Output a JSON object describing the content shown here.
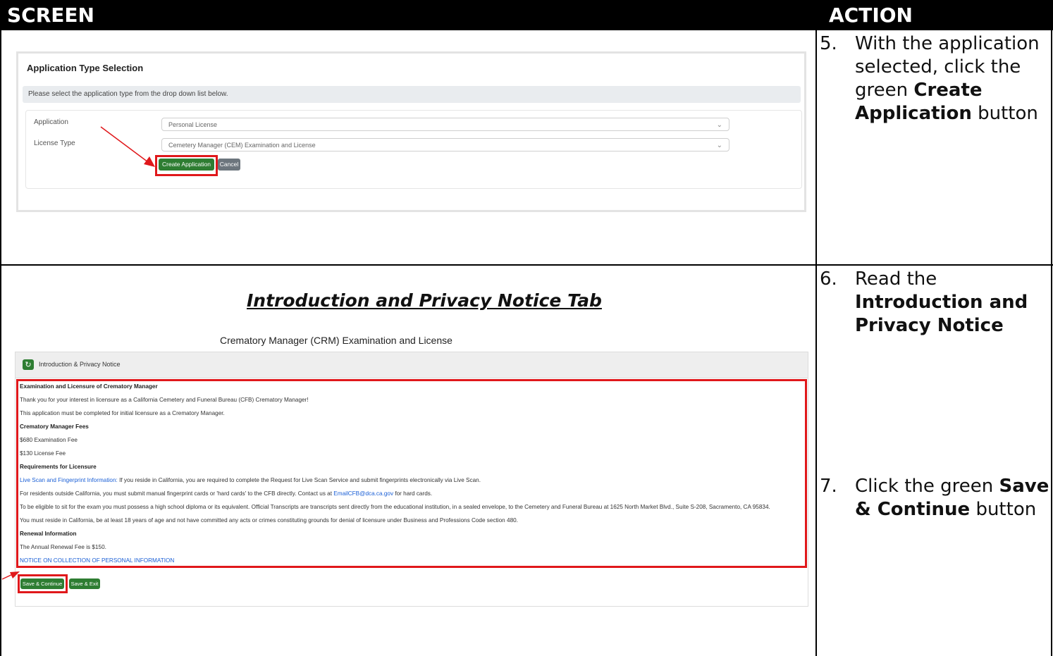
{
  "headers": {
    "screen": "SCREEN",
    "action": "ACTION"
  },
  "step5": {
    "num": "5.",
    "text_before": "With the application selected, click the green ",
    "bold": "Create Application",
    "text_after": " button"
  },
  "step6": {
    "num": "6.",
    "text_before": "Read the ",
    "bold": "Introduction and Privacy Notice"
  },
  "step7": {
    "num": "7.",
    "text_before": "Click the green ",
    "bold": "Save & Continue",
    "text_after": " button"
  },
  "shot1": {
    "title": "Application Type Selection",
    "notice": "Please select the application type from the drop down list below.",
    "application_label": "Application",
    "application_value": "Personal License",
    "license_label": "License Type",
    "license_value": "Cemetery Manager (CEM) Examination and License",
    "create_button": "Create Application",
    "cancel_button": "Cancel"
  },
  "section_title": "Introduction and Privacy Notice Tab",
  "shot2": {
    "app_title": "Crematory Manager (CRM) Examination and License",
    "tab_label": "Introduction & Privacy Notice",
    "lines": {
      "l1": "Examination and Licensure of Crematory Manager",
      "l2": "Thank you for your interest in licensure as a California Cemetery and Funeral Bureau (CFB) Crematory Manager!",
      "l3": "This application must be completed for initial licensure as a Crematory Manager.",
      "l4": "Crematory Manager Fees",
      "l5": "$680 Examination Fee",
      "l6": "$130 License Fee",
      "l7": "Requirements for Licensure",
      "l8_link": "Live Scan and Fingerprint Information:",
      "l8_rest": " If you reside in California, you are required to complete the Request for Live Scan Service and submit fingerprints electronically via Live Scan.",
      "l9_a": "For residents outside California, you must submit manual fingerprint cards or 'hard cards' to the CFB directly. Contact us at ",
      "l9_link": "EmailCFB@dca.ca.gov",
      "l9_b": " for hard cards.",
      "l10": "To be eligible to sit for the exam you must possess a high school diploma or its equivalent. Official Transcripts are transcripts sent directly from the educational institution, in a sealed envelope, to the Cemetery and Funeral Bureau at 1625 North Market Blvd., Suite S-208, Sacramento, CA 95834.",
      "l11": "You must reside in California, be at least 18 years of age and not have committed any acts or crimes constituting grounds for denial of licensure under Business and Professions Code section 480.",
      "l12": "Renewal Information",
      "l13": "The Annual Renewal Fee is $150.",
      "l14": "NOTICE ON COLLECTION OF PERSONAL INFORMATION"
    },
    "save_continue": "Save & Continue",
    "save_exit": "Save & Exit"
  },
  "colors": {
    "green": "#2e7d32",
    "red": "#e0181b",
    "gray": "#6c757d",
    "link": "#1a5fd6"
  }
}
